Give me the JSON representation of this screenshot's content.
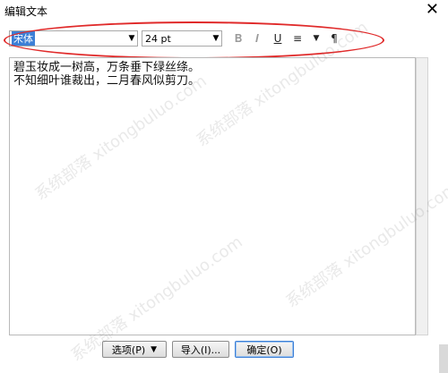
{
  "window": {
    "title": "编辑文本",
    "close_glyph": "✕"
  },
  "toolbar": {
    "font_value": "宋体",
    "size_value": "24 pt",
    "icons": [
      "bold-icon",
      "italic-icon",
      "underline-icon",
      "align-icon",
      "align-dropdown-icon",
      "paragraph-icon"
    ]
  },
  "editor": {
    "lines": [
      "碧玉妆成一树高，万条垂下绿丝绦。",
      "不知细叶谁裁出，二月春风似剪刀。"
    ]
  },
  "buttons": {
    "options_label": "选项(P)",
    "import_label": "导入(I)...",
    "ok_label": "确定(O)"
  },
  "watermark": {
    "text": "系统部落 xitongbuluo.com"
  },
  "colors": {
    "highlight": "#e02a2a",
    "selection": "#3c7fd6"
  }
}
